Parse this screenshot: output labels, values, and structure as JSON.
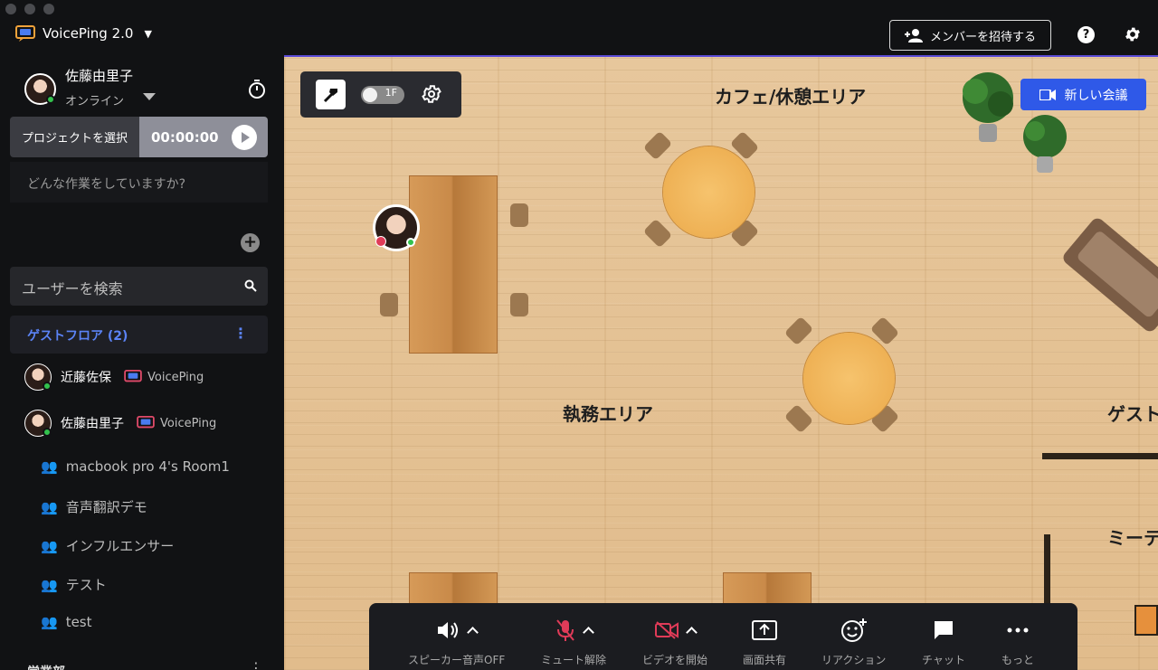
{
  "app": {
    "title": "VoicePing 2.0"
  },
  "header": {
    "invite_label": "メンバーを招待する",
    "help_label": "?"
  },
  "me": {
    "name": "佐藤由里子",
    "status": "オンライン"
  },
  "project": {
    "select_label": "プロジェクトを選択",
    "time": "00:00:00"
  },
  "task": {
    "placeholder": "どんな作業をしていますか?"
  },
  "search": {
    "placeholder": "ユーザーを検索"
  },
  "floor": {
    "name": "ゲストフロア (2)"
  },
  "users": [
    {
      "name": "近藤佐保",
      "app": "VoicePing"
    },
    {
      "name": "佐藤由里子",
      "app": "VoicePing"
    }
  ],
  "rooms": [
    "macbook pro 4's Room1",
    "音声翻訳デモ",
    "インフルエンサー",
    "テスト",
    "test"
  ],
  "next_section": "営業部",
  "map": {
    "areas": [
      "カフェ/休憩エリア",
      "執務エリア",
      "ゲスト",
      "ミーテ"
    ],
    "new_meeting_label": "新しい会議",
    "toggle_label": "1F"
  },
  "controls": [
    {
      "label": "スピーカー音声OFF",
      "icon": "speaker-icon"
    },
    {
      "label": "ミュート解除",
      "icon": "mic-off-icon"
    },
    {
      "label": "ビデオを開始",
      "icon": "video-off-icon"
    },
    {
      "label": "画面共有",
      "icon": "screen-share-icon"
    },
    {
      "label": "リアクション",
      "icon": "reaction-icon"
    },
    {
      "label": "チャット",
      "icon": "chat-icon"
    },
    {
      "label": "もっと",
      "icon": "more-icon"
    }
  ],
  "colors": {
    "accent": "#2f59e8",
    "floor_text": "#5b83f6",
    "online": "#33c24d",
    "muted": "#e03b58"
  }
}
